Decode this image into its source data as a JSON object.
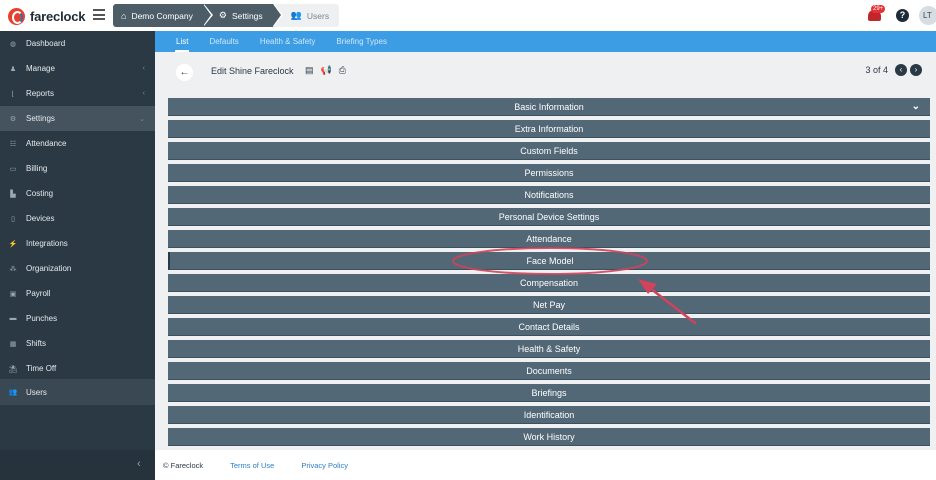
{
  "app": {
    "logo_text": "fareclock"
  },
  "breadcrumbs": [
    {
      "label": "Demo Company",
      "icon": "home-icon"
    },
    {
      "label": "Settings",
      "icon": "gear-icon"
    },
    {
      "label": "Users",
      "icon": "users-icon"
    }
  ],
  "header": {
    "notification_count": "29+",
    "help_icon": "?",
    "avatar_initials": "LT"
  },
  "sidebar": {
    "items": [
      {
        "label": "Dashboard",
        "icon": "dashboard-icon"
      },
      {
        "label": "Manage",
        "icon": "manage-icon"
      },
      {
        "label": "Reports",
        "icon": "reports-icon"
      },
      {
        "label": "Settings",
        "icon": "settings-icon"
      },
      {
        "label": "Attendance",
        "icon": "attendance-icon"
      },
      {
        "label": "Billing",
        "icon": "billing-icon"
      },
      {
        "label": "Costing",
        "icon": "costing-icon"
      },
      {
        "label": "Devices",
        "icon": "devices-icon"
      },
      {
        "label": "Integrations",
        "icon": "integrations-icon"
      },
      {
        "label": "Organization",
        "icon": "organization-icon"
      },
      {
        "label": "Payroll",
        "icon": "payroll-icon"
      },
      {
        "label": "Punches",
        "icon": "punches-icon"
      },
      {
        "label": "Shifts",
        "icon": "shifts-icon"
      },
      {
        "label": "Time Off",
        "icon": "time-off-icon"
      },
      {
        "label": "Users",
        "icon": "users-icon"
      }
    ],
    "collapse_icon": "‹"
  },
  "subnav": {
    "tabs": [
      "List",
      "Defaults",
      "Health & Safety",
      "Briefing Types"
    ],
    "active": "List"
  },
  "main": {
    "edit_title": "Edit Shine Fareclock",
    "pager_text": "3 of 4",
    "sections": [
      "Basic Information",
      "Extra Information",
      "Custom Fields",
      "Permissions",
      "Notifications",
      "Personal Device Settings",
      "Attendance",
      "Face Model",
      "Compensation",
      "Net Pay",
      "Contact Details",
      "Health & Safety",
      "Documents",
      "Briefings",
      "Identification",
      "Work History"
    ],
    "highlighted_section": "Face Model"
  },
  "footer": {
    "copyright": "© Fareclock",
    "terms": "Terms of Use",
    "privacy": "Privacy Policy"
  },
  "colors": {
    "sidebar": "#2b3944",
    "subnav": "#3d9de4",
    "section_bar": "#526877",
    "annotation": "#d0435a"
  }
}
